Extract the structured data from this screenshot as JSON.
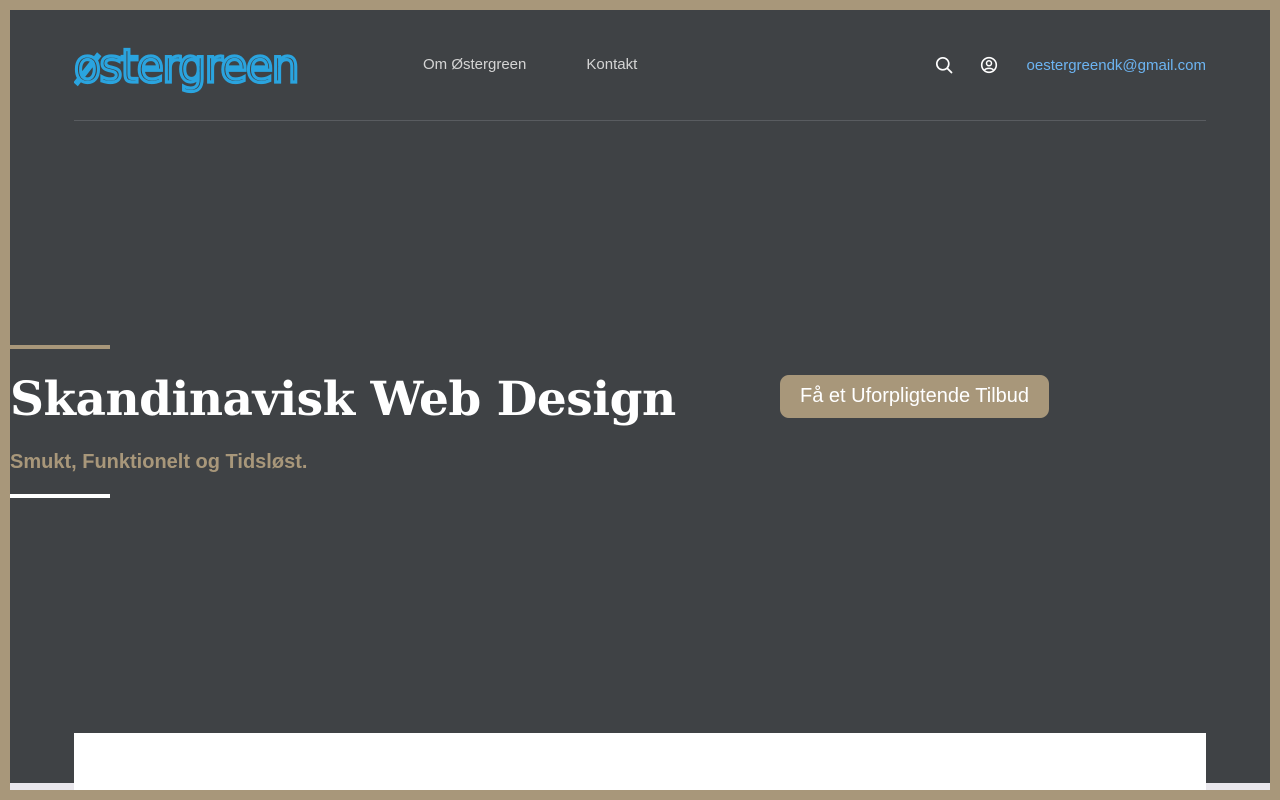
{
  "brand": {
    "logo_text": "østergreen",
    "logo_color": "#2aa4df"
  },
  "nav": {
    "items": [
      {
        "label": "Om Østergreen"
      },
      {
        "label": "Kontakt"
      }
    ]
  },
  "header_actions": {
    "search_icon": "search-icon",
    "account_icon": "user-circle-icon",
    "email": "oestergreendk@gmail.com"
  },
  "hero": {
    "title": "Skandinavisk Web Design",
    "subtitle": "Smukt, Funktionelt og Tidsløst.",
    "cta_label": "Få et Uforpligtende Tilbud"
  },
  "colors": {
    "background": "#3f4245",
    "accent": "#a8977a",
    "link": "#6cb4f2"
  }
}
